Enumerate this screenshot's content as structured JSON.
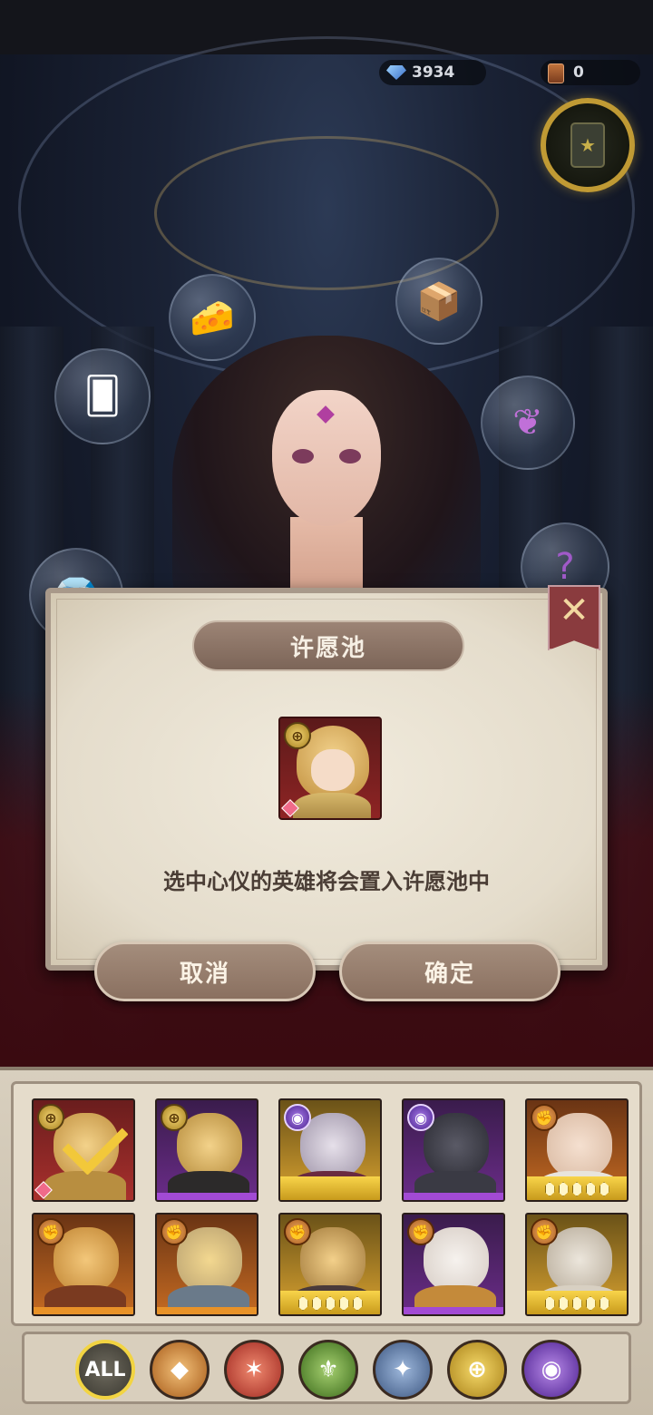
{
  "currency": {
    "gems": "3934",
    "tickets": "0"
  },
  "dialog": {
    "title": "许愿池",
    "message": "选中心仪的英雄将会置入许愿池中",
    "cancel_label": "取消",
    "confirm_label": "确定",
    "close_glyph": "✕"
  },
  "filters": {
    "all_label": "ALL"
  },
  "icons": {
    "gem": "diamond-icon",
    "ticket": "ticket-icon",
    "close": "close-icon",
    "check": "checkmark-icon"
  },
  "colors": {
    "dialog_bg": "#ece5d6",
    "button_fill": "#9a8272",
    "close_bg": "#8a3b3e",
    "selected_check": "#f2c83a"
  }
}
